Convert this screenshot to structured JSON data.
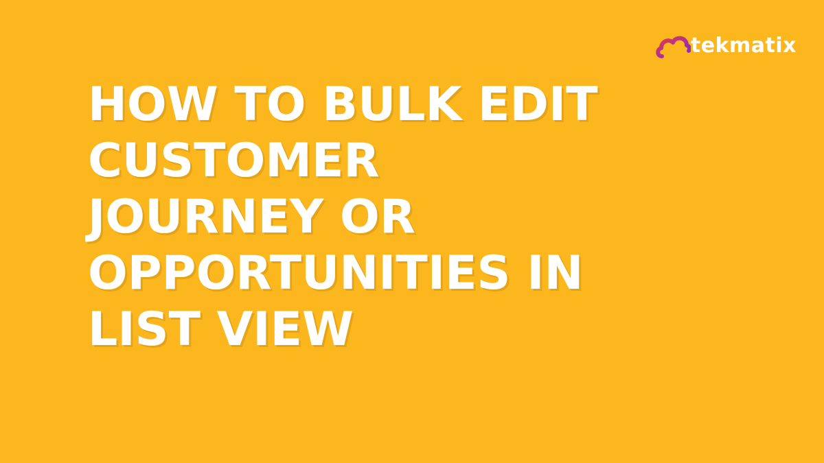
{
  "brand": {
    "name": "tekmatix",
    "icon": "cloud-logo-icon",
    "colors": {
      "background": "#FCB71E",
      "text": "#FFFFFF",
      "logo_gradient_start": "#E5394A",
      "logo_gradient_end": "#7A2BD8"
    }
  },
  "headline": {
    "lines": [
      "HOW TO BULK EDIT",
      "CUSTOMER",
      "JOURNEY OR",
      "OPPORTUNITIES IN",
      "LIST VIEW"
    ]
  }
}
